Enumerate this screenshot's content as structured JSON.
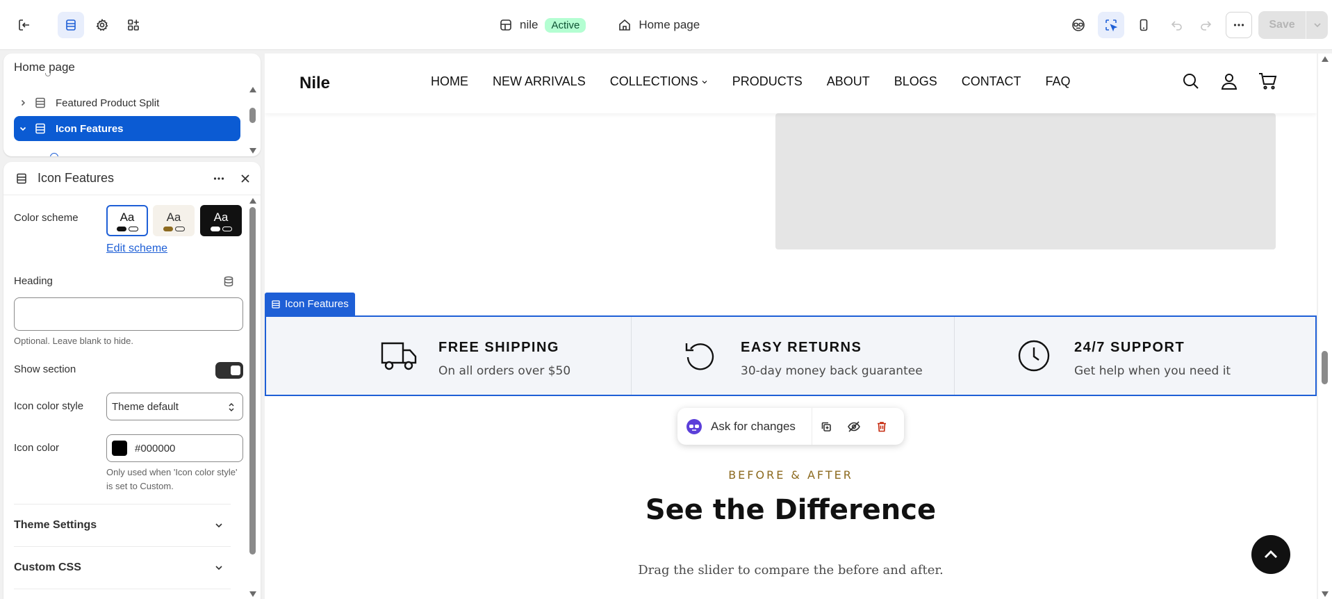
{
  "topbar": {
    "store_name": "nile",
    "store_status": "Active",
    "page_name": "Home page",
    "save_label": "Save"
  },
  "tree": {
    "title": "Home page",
    "items": [
      {
        "label": "Featured Product Split",
        "selected": false
      },
      {
        "label": "Icon Features",
        "selected": true
      }
    ]
  },
  "settings": {
    "title": "Icon Features",
    "color_scheme_label": "Color scheme",
    "schemes": [
      {
        "sample": "Aa",
        "bg": "#ffffff",
        "fg": "#111111",
        "accent": "#111111",
        "selected": true
      },
      {
        "sample": "Aa",
        "bg": "#f5f1ea",
        "fg": "#303030",
        "accent": "#8c6a1f",
        "selected": false
      },
      {
        "sample": "Aa",
        "bg": "#111111",
        "fg": "#ffffff",
        "accent": "#ffffff",
        "selected": false
      }
    ],
    "edit_scheme_label": "Edit scheme",
    "heading_label": "Heading",
    "heading_value": "",
    "heading_help": "Optional. Leave blank to hide.",
    "show_section_label": "Show section",
    "show_section_on": true,
    "icon_color_style_label": "Icon color style",
    "icon_color_style_value": "Theme default",
    "icon_color_label": "Icon color",
    "icon_color_value": "#000000",
    "icon_color_help": "Only used when 'Icon color style' is set to Custom.",
    "accordions": [
      "Theme Settings",
      "Custom CSS"
    ]
  },
  "site": {
    "logo": "Nile",
    "nav": [
      "HOME",
      "NEW ARRIVALS",
      "COLLECTIONS",
      "PRODUCTS",
      "ABOUT",
      "BLOGS",
      "CONTACT",
      "FAQ"
    ]
  },
  "section_tag": "Icon Features",
  "features": [
    {
      "icon": "truck-icon",
      "title": "FREE SHIPPING",
      "subtitle": "On all orders over $50"
    },
    {
      "icon": "returns-icon",
      "title": "EASY RETURNS",
      "subtitle": "30-day money back guarantee"
    },
    {
      "icon": "clock-icon",
      "title": "24/7 SUPPORT",
      "subtitle": "Get help when you need it"
    }
  ],
  "ai_bar": {
    "label": "Ask for changes"
  },
  "before_after": {
    "eyebrow": "BEFORE & AFTER",
    "title": "See the Difference",
    "description": "Drag the slider to compare the before and after."
  },
  "colors": {
    "accent": "#1e5fd6",
    "selected_tree": "#0b5bd3",
    "status_active": "#b4fed2"
  }
}
